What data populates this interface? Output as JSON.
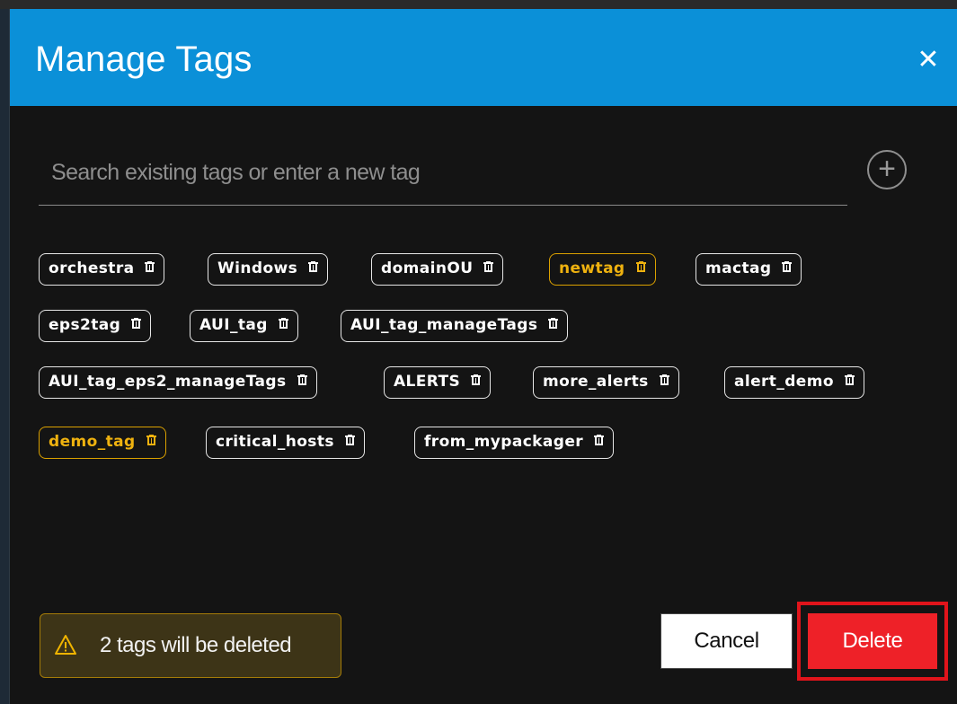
{
  "dialog": {
    "title": "Manage Tags",
    "close_icon": "close-icon",
    "search": {
      "placeholder": "Search existing tags or enter a new tag",
      "value": ""
    },
    "add_icon": "plus-circle-icon",
    "tags": [
      {
        "label": "orchestra",
        "marked": false
      },
      {
        "label": "Windows",
        "marked": false
      },
      {
        "label": "domainOU",
        "marked": false
      },
      {
        "label": "newtag",
        "marked": true
      },
      {
        "label": "mactag",
        "marked": false
      },
      {
        "label": "eps2tag",
        "marked": false
      },
      {
        "label": "AUI_tag",
        "marked": false
      },
      {
        "label": "AUI_tag_manageTags",
        "marked": false
      },
      {
        "label": "AUI_tag_eps2_manageTags",
        "marked": false
      },
      {
        "label": "ALERTS",
        "marked": false
      },
      {
        "label": "more_alerts",
        "marked": false
      },
      {
        "label": "alert_demo",
        "marked": false
      },
      {
        "label": "demo_tag",
        "marked": true
      },
      {
        "label": "critical_hosts",
        "marked": false
      },
      {
        "label": "from_mypackager",
        "marked": false
      }
    ],
    "warning": {
      "icon": "warning-icon",
      "text": "2 tags will be deleted"
    },
    "buttons": {
      "cancel": "Cancel",
      "delete": "Delete"
    },
    "colors": {
      "header": "#0b90d8",
      "marked_tag": "#efb20f",
      "delete_button": "#ee2128",
      "highlight_box": "#e0141b",
      "warning_bg": "#3d3417"
    }
  }
}
